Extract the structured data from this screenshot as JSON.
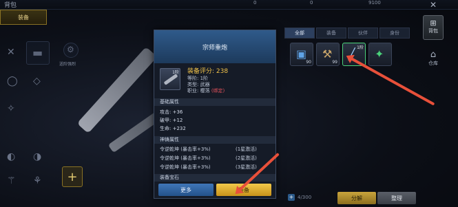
{
  "topbar": {
    "bag_title": "背包",
    "res1": "0",
    "res2": "0",
    "res3": "9100"
  },
  "left": {
    "equip_tab": "装备",
    "slot_label": "送阶强烈"
  },
  "right": {
    "tabs": [
      "全部",
      "装备",
      "伙伴",
      "身份"
    ],
    "items": [
      {
        "count": "90",
        "badge": "",
        "icon": "gift-box-icon"
      },
      {
        "count": "99",
        "badge": "",
        "icon": "wrench-icon"
      },
      {
        "count": "",
        "badge": "1阶",
        "icon": "rifle-icon"
      },
      {
        "count": "",
        "badge": "",
        "icon": "green-gun-icon"
      }
    ],
    "bag_label": "背包",
    "storage_label": "仓库",
    "capacity": "4/300",
    "split_label": "分解",
    "sort_label": "整理"
  },
  "popup": {
    "title": "宗师重炮",
    "thumb_level": "1阶",
    "score": "装备评分: 238",
    "grade": "等阶: 1阶",
    "type": "类型: 武器",
    "job_prefix": "职业: 樱落 ",
    "job_tag": "(绑定)",
    "base_title": "基础属性",
    "stats": [
      "攻击: +36",
      "破甲: +12",
      "生命: +232"
    ],
    "forge_title": "神铸属性",
    "forge": [
      {
        "text": "令逆乾坤 (暴击率+3%)",
        "level": "(1星激活)"
      },
      {
        "text": "令逆乾坤 (暴击率+3%)",
        "level": "(2星激活)"
      },
      {
        "text": "令逆乾坤 (暴击率+3%)",
        "level": "(3星激活)"
      }
    ],
    "gem_title": "装备宝石",
    "more_label": "更多",
    "equip_label": "装备"
  },
  "colors": {
    "accent_gold": "#f2c94a",
    "header_blue": "#2f5a8a",
    "arrow_red": "#e8503a"
  }
}
